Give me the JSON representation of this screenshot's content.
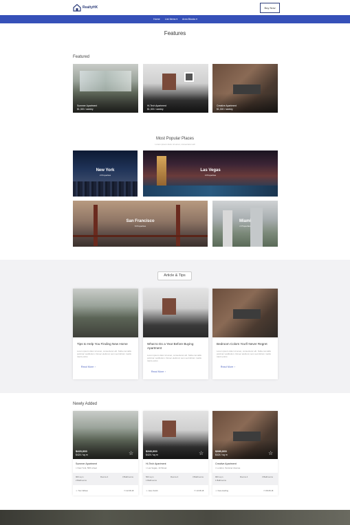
{
  "header": {
    "logo_text": "RealtyHK",
    "buy_label": "Buy Now",
    "nav": [
      "Home",
      "List Items",
      "Area Blocks"
    ]
  },
  "page_title": "Features",
  "featured": {
    "title": "Featured",
    "items": [
      {
        "name": "Summer Apartment",
        "price": "$1,300 / weekly"
      },
      {
        "name": "Hi-Tech Apartment",
        "price": "$1,300 / weekly"
      },
      {
        "name": "Creative Apartment",
        "price": "$1,300 / weekly"
      }
    ]
  },
  "popular": {
    "title": "Most Popular Places",
    "subtitle": "Lorem ipsum dolor sit amet, consectetur adi",
    "places": [
      {
        "name": "New York",
        "count": "2 Properties"
      },
      {
        "name": "Las Vegas",
        "count": "4 Properties"
      },
      {
        "name": "San Francisco",
        "count": "6 Properties"
      },
      {
        "name": "Miami",
        "count": "2 Properties"
      }
    ]
  },
  "articles": {
    "title": "Article & Tips",
    "items": [
      {
        "title": "Tips to Help You Finding New Home",
        "text": "Lorem ipsum dolor sit amet, consectetur elit. Nulla convallis pulvinar vestibulum. Donec eleifend, sem sed dictum mattis turpis purus",
        "more": "Read More"
      },
      {
        "title": "What to Do a Year Before Buying Apartment",
        "text": "Lorem ipsum dolor sit amet, consectetur elit. Nulla convallis pulvinar vestibulum. Donec eleifend, sem sed dictum mattis turpis purus",
        "more": "Read More"
      },
      {
        "title": "Bedroom Colors You'll Never Regret",
        "text": "Lorem ipsum dolor sit amet, consectetur elit. Nulla convallis pulvinar vestibulum. Donec eleifend, sem sed dictum mattis turpis purus",
        "more": "Read More"
      }
    ]
  },
  "newly": {
    "title": "Newly Added",
    "items": [
      {
        "price": "$420,000",
        "rate": "$424 / sq m",
        "name": "Summer Apartment",
        "loc": "New York, 56th street",
        "specs": [
          "900 sq m",
          "Rooms 4",
          "3 Bathrooms",
          "2 Bathrooms"
        ],
        "agent": "Tom Wilson",
        "date": "22.08.18"
      },
      {
        "price": "$340,000",
        "rate": "$424 / sq m",
        "name": "Hi-Tech Apartment",
        "loc": "Las Vegas, 14 Street",
        "specs": [
          "500 sq m",
          "Rooms 4",
          "3 Bathrooms",
          "1 Bathrooms"
        ],
        "agent": "Jane Smith",
        "date": "13.08.18"
      },
      {
        "price": "$380,000",
        "rate": "$424 / sq m",
        "name": "Creative Apartment",
        "loc": "London, Summer Avenue",
        "specs": [
          "900 sq m",
          "Rooms 4",
          "3 Bathrooms",
          "1 Bathrooms"
        ],
        "agent": "Kate Harling",
        "date": "08.08.18"
      }
    ]
  },
  "colors": {
    "accent": "#3650b8",
    "brand": "#2d3d7a"
  }
}
